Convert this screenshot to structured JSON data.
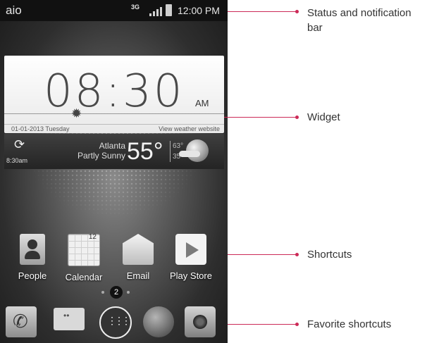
{
  "status_bar": {
    "carrier": "aio",
    "network": "3G",
    "time": "12:00 PM"
  },
  "clock_widget": {
    "time": "08:30",
    "ampm": "AM",
    "date": "01-01-2013  Tuesday",
    "weather_link": "View weather website"
  },
  "weather_widget": {
    "updated": "8:30am",
    "city": "Atlanta",
    "condition": "Partly Sunny",
    "temperature": "55°",
    "high": "63°",
    "low": "35°"
  },
  "shortcuts": [
    {
      "label": "People"
    },
    {
      "label": "Calendar"
    },
    {
      "label": "Email"
    },
    {
      "label": "Play Store"
    }
  ],
  "page_indicator": {
    "current": "2"
  },
  "callouts": {
    "status": "Status and notification bar",
    "widget": "Widget",
    "shortcuts": "Shortcuts",
    "favorites": "Favorite shortcuts"
  },
  "colors": {
    "callout": "#cc2a57"
  }
}
